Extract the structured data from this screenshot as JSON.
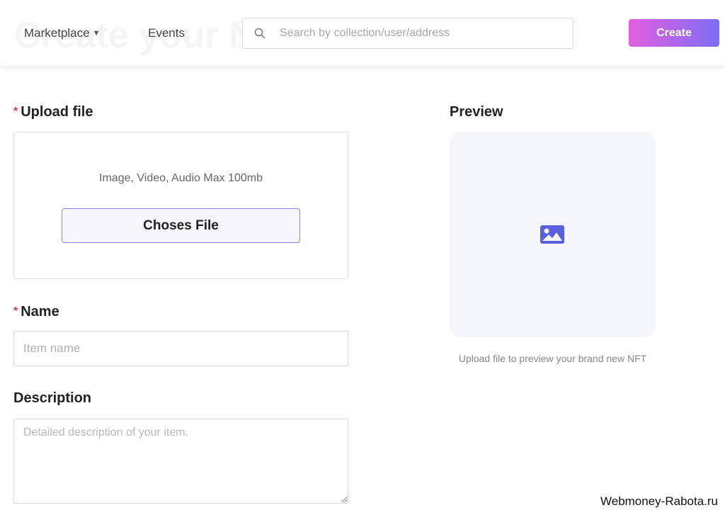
{
  "header": {
    "ghost_title": "Create your NFT",
    "nav": {
      "marketplace": "Marketplace",
      "events": "Events"
    },
    "search": {
      "placeholder": "Search by collection/user/address"
    },
    "create_label": "Create"
  },
  "form": {
    "upload": {
      "label": "Upload file",
      "hint": "Image, Video, Audio Max 100mb",
      "button": "Choses File"
    },
    "name": {
      "label": "Name",
      "placeholder": "Item name"
    },
    "description": {
      "label": "Description",
      "placeholder": "Detailed description of your item."
    }
  },
  "preview": {
    "label": "Preview",
    "caption": "Upload file to preview your brand new NFT",
    "icon": "image-icon"
  },
  "watermark": "Webmoney-Rabota.ru",
  "colors": {
    "accent_start": "#e35ee0",
    "accent_end": "#7c6ef4",
    "required": "#e0393e",
    "icon": "#5b5ee0",
    "preview_bg": "#f5f6fb"
  }
}
